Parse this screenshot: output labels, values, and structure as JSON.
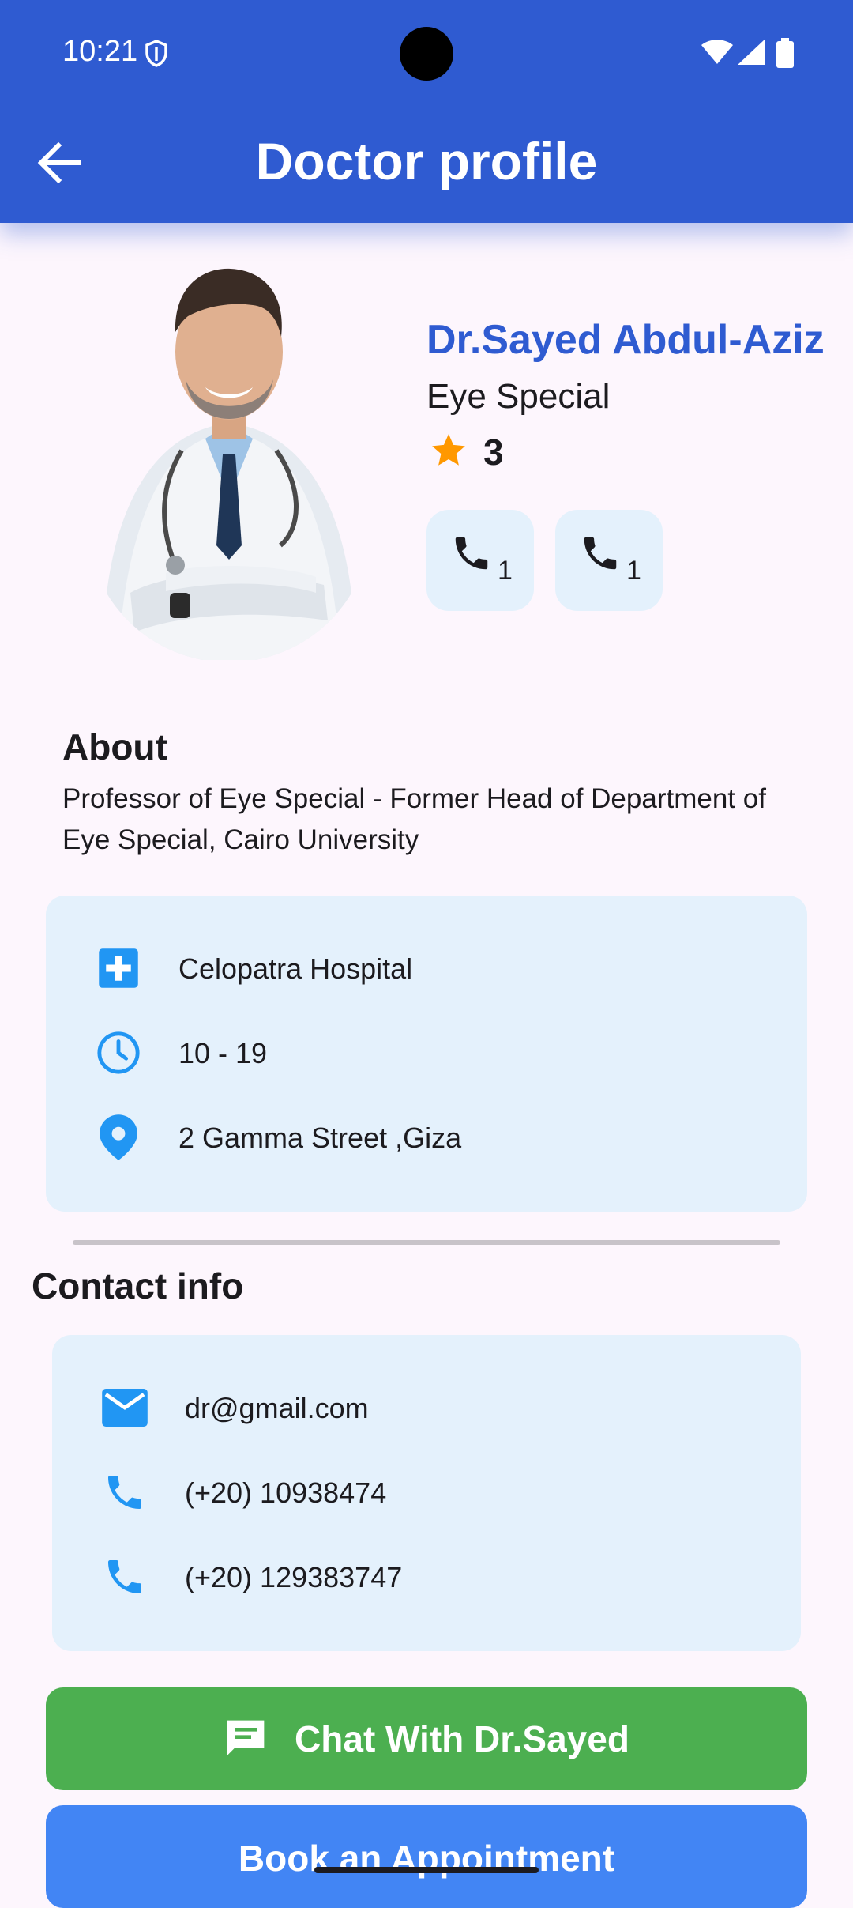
{
  "status_bar": {
    "time": "10:21"
  },
  "app_bar": {
    "title": "Doctor profile",
    "color": "#2f5bd1"
  },
  "doctor": {
    "name": "Dr.Sayed Abdul-Aziz",
    "specialty": "Eye Special",
    "rating": "3",
    "call_chips": [
      {
        "icon": "phone-icon",
        "count": "1"
      },
      {
        "icon": "phone-icon",
        "count": "1"
      }
    ]
  },
  "about": {
    "heading": "About",
    "text": "Professor of Eye Special - Former Head of Department of Eye Special, Cairo University"
  },
  "details": {
    "hospital": "Celopatra Hospital",
    "hours": "10 - 19",
    "address": "2 Gamma Street ,Giza"
  },
  "contact": {
    "heading": "Contact info",
    "email": "dr@gmail.com",
    "phones": [
      "(+20) 10938474",
      "(+20) 129383747"
    ]
  },
  "actions": {
    "chat_label": "Chat With Dr.Sayed",
    "book_label": "Book an Appointment"
  },
  "colors": {
    "primary": "#2f5bd1",
    "icon_blue": "#2196f3",
    "card_bg": "#e4f1fc",
    "chat_green": "#4caf50",
    "book_blue": "#4285f4",
    "star": "#ff9800"
  }
}
